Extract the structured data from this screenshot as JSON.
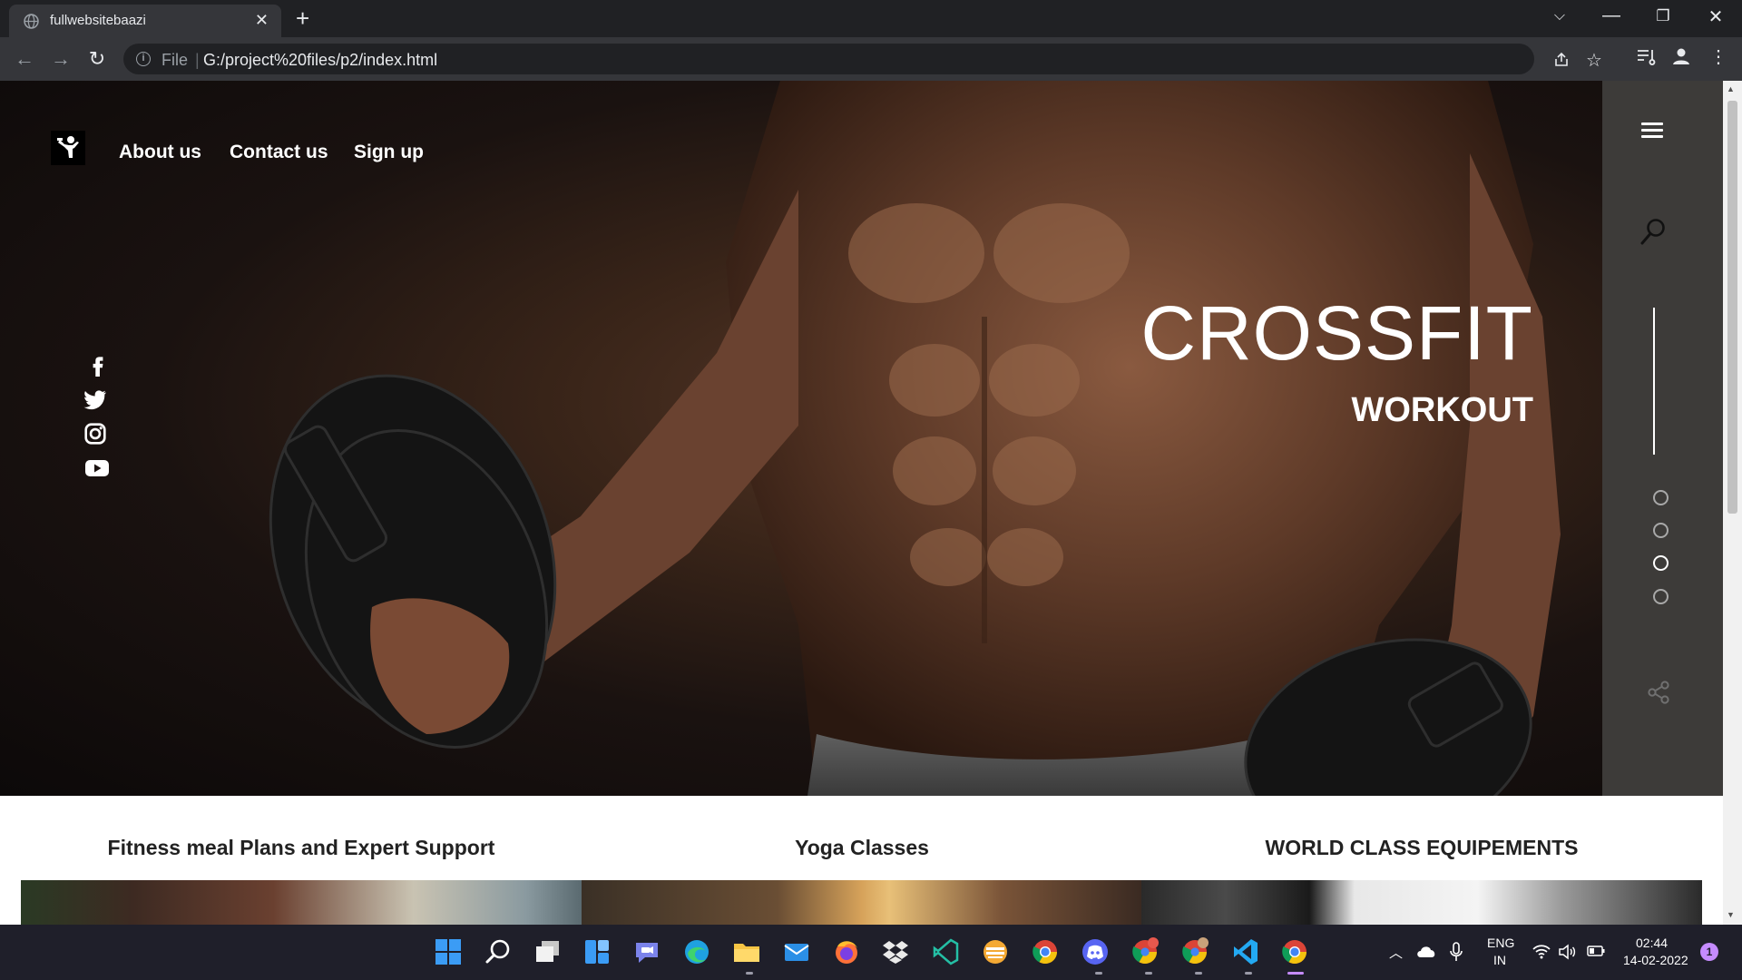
{
  "browser": {
    "tab_title": "fullwebsitebaazi",
    "url_scheme": "File",
    "url": "G:/project%20files/p2/index.html"
  },
  "page": {
    "nav": [
      {
        "label": "About us"
      },
      {
        "label": "Contact us"
      },
      {
        "label": "Sign up"
      }
    ],
    "social_icons": [
      "facebook-icon",
      "twitter-icon",
      "instagram-icon",
      "youtube-icon"
    ],
    "hero": {
      "title": "CROSSFIT",
      "subtitle": "WORKOUT"
    },
    "side_panel": {
      "slide_count": 4,
      "active_slide": 3
    },
    "services": [
      {
        "title": "Fitness meal Plans and Expert Support"
      },
      {
        "title": "Yoga Classes"
      },
      {
        "title": "WORLD CLASS EQUIPEMENTS"
      }
    ]
  },
  "taskbar": {
    "apps": [
      "windows-start",
      "search",
      "task-view",
      "widgets",
      "teams-chat",
      "edge",
      "file-explorer",
      "mail",
      "firefox",
      "dropbox",
      "vscode-insiders",
      "sublime",
      "chrome",
      "discord",
      "chrome-profile-p",
      "chrome-profile",
      "vscode",
      "chrome-active"
    ],
    "language_line1": "ENG",
    "language_line2": "IN",
    "time": "02:44",
    "date": "14-02-2022",
    "notification_count": "1"
  },
  "colors": {
    "side_panel": "#3d3b39",
    "chrome_dark": "#202124",
    "chrome_toolbar": "#35363a",
    "taskbar": "#1f1f2a"
  }
}
